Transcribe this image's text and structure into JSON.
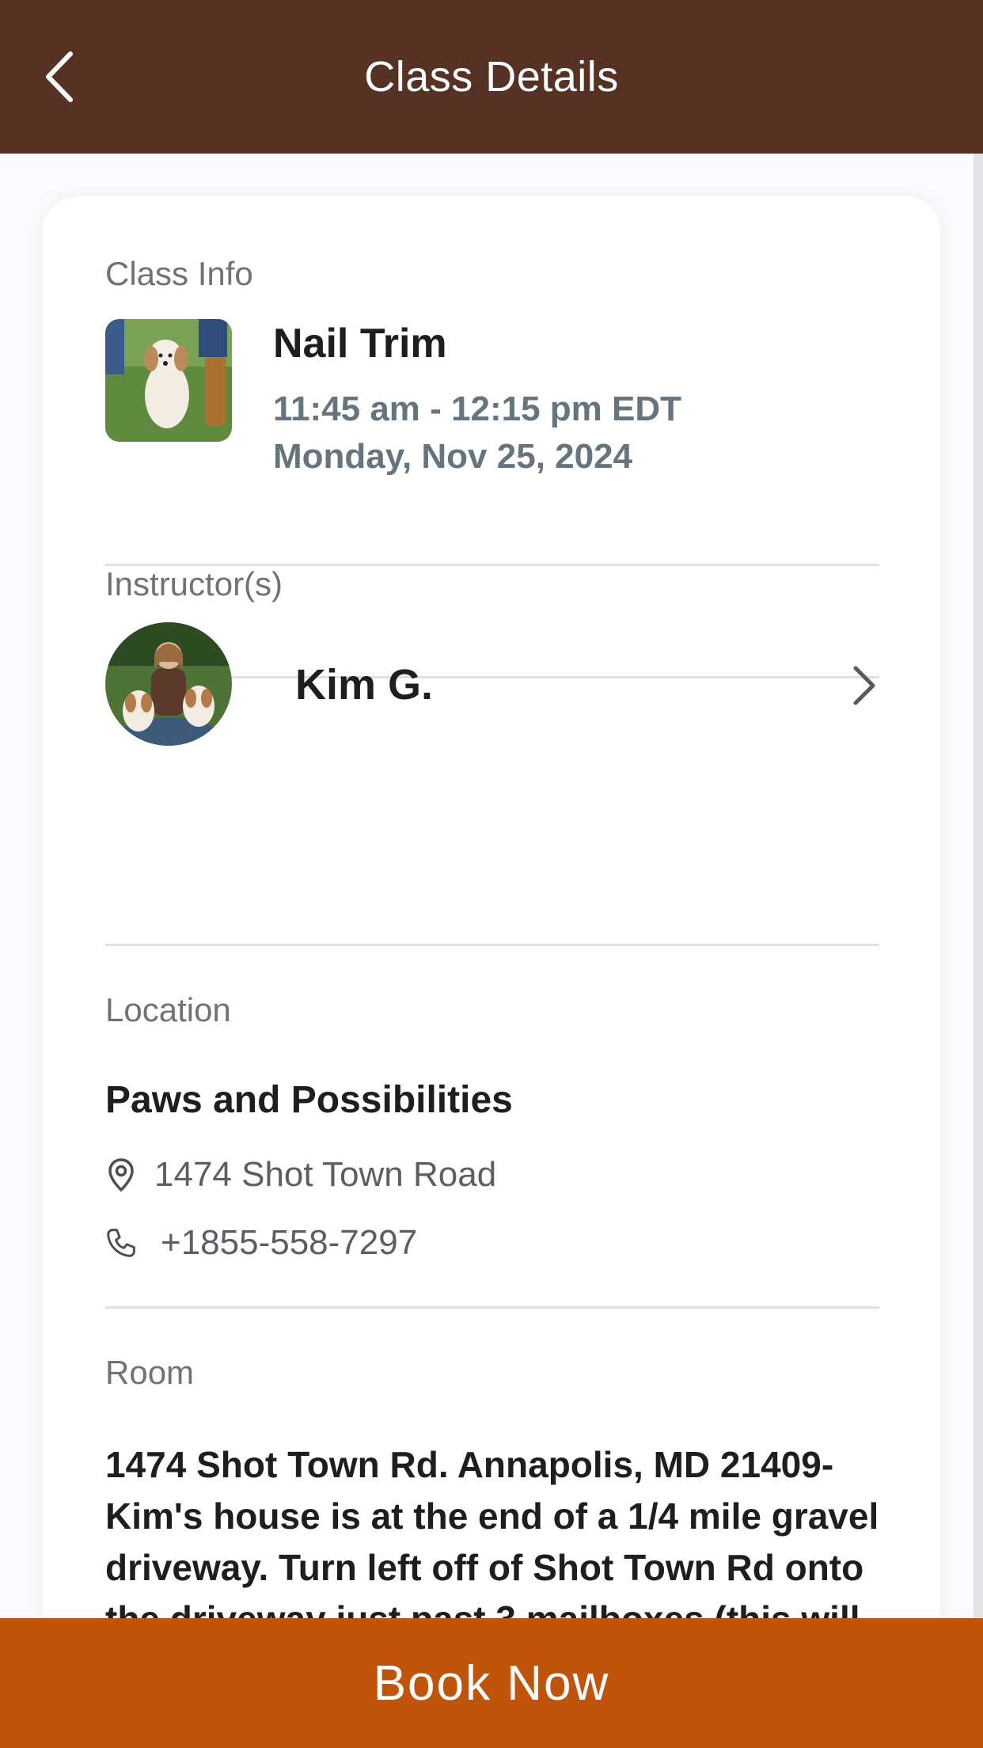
{
  "header": {
    "title": "Class Details"
  },
  "class_info": {
    "section_label": "Class Info",
    "name": "Nail Trim",
    "time": "11:45 am - 12:15 pm EDT",
    "date": "Monday, Nov 25, 2024"
  },
  "instructors": {
    "section_label": "Instructor(s)",
    "name": "Kim G."
  },
  "location": {
    "section_label": "Location",
    "name": "Paws and Possibilities",
    "address": "1474 Shot Town Road",
    "phone": "+1855-558-7297"
  },
  "room": {
    "section_label": "Room",
    "text": "1474 Shot Town Rd. Annapolis, MD 21409- Kim's house is at the end of a 1/4 mile gravel driveway. Turn left off of Shot Town Rd onto the driveway just past 3 mailboxes (this will be after the GPS indicates you have arrived). Follow the gravel road to the end and park by the red"
  },
  "footer": {
    "book_label": "Book Now"
  },
  "colors": {
    "header_bg": "#553224",
    "accent": "#c0540b",
    "muted_text": "#66747e"
  }
}
